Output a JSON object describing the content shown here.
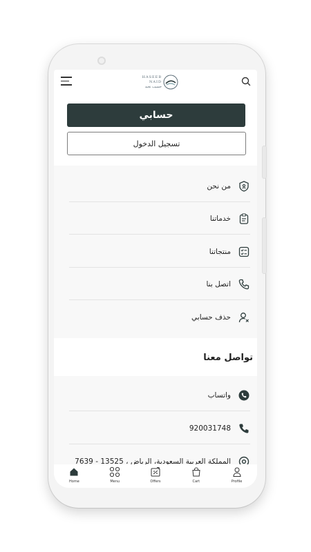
{
  "header": {
    "logo_en": "HASEEB NAID",
    "logo_ar": "حسيب نجيد"
  },
  "account": {
    "title": "حسابي",
    "login_label": "تسجيل الدخول"
  },
  "menu": {
    "items": [
      {
        "label": "من نحن",
        "icon": "shield-user-icon"
      },
      {
        "label": "خدماتنا",
        "icon": "clipboard-icon"
      },
      {
        "label": "منتجاتنا",
        "icon": "checklist-icon"
      },
      {
        "label": "اتصل بنا",
        "icon": "phone-icon"
      },
      {
        "label": "حذف حسابي",
        "icon": "user-remove-icon"
      }
    ]
  },
  "contact": {
    "title": "تواصل معنا",
    "items": [
      {
        "label": "واتساب",
        "icon": "whatsapp-icon"
      },
      {
        "label": "920031748",
        "icon": "phone-icon"
      },
      {
        "label": "المملكة العربية السعودية، الرياض ، 13525 - 7639",
        "icon": "location-icon"
      }
    ]
  },
  "nav": {
    "items": [
      {
        "label": "Home",
        "icon": "home-icon"
      },
      {
        "label": "Menu",
        "icon": "grid-icon"
      },
      {
        "label": "Offers",
        "icon": "offers-icon"
      },
      {
        "label": "Cart",
        "icon": "bag-icon"
      },
      {
        "label": "Profile",
        "icon": "profile-icon"
      }
    ]
  },
  "colors": {
    "primary": "#2d3c3c",
    "background": "#ffffff",
    "list_background": "#f8f8f8"
  }
}
